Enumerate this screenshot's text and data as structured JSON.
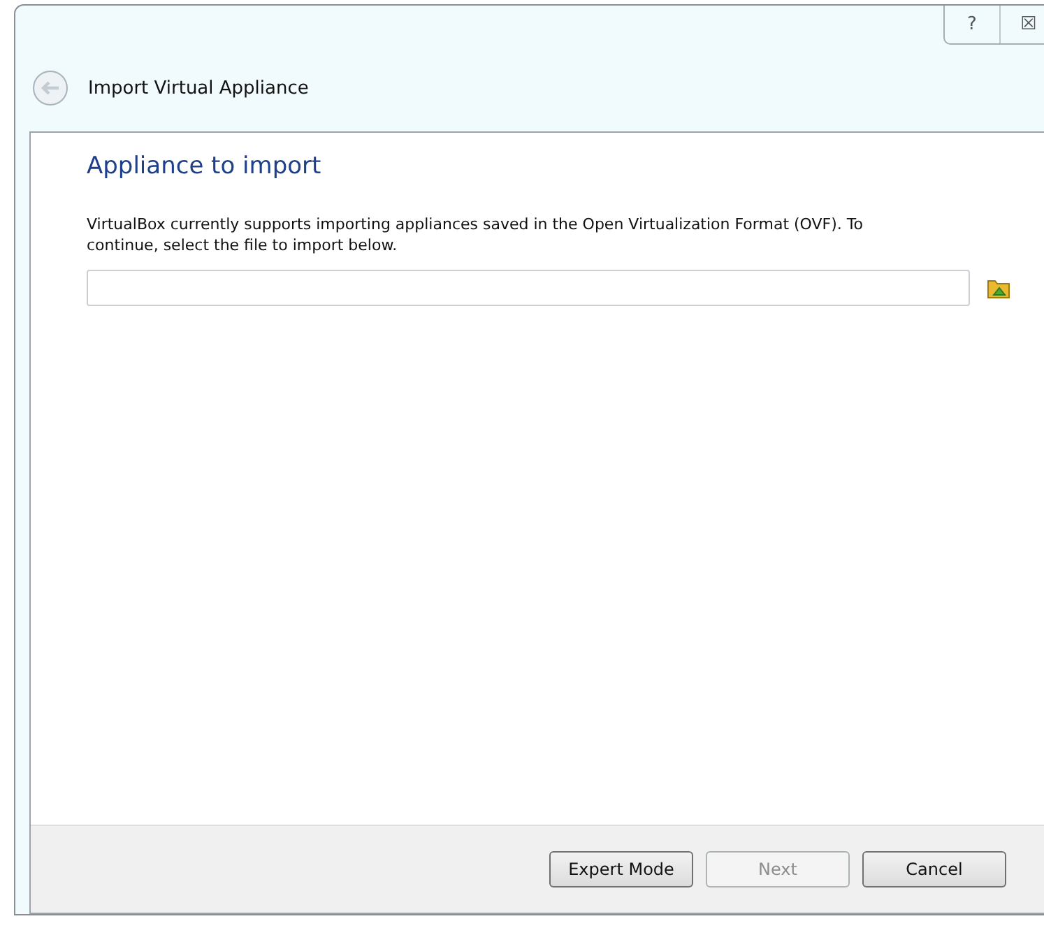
{
  "window": {
    "help_button": "?",
    "close_button": "☒"
  },
  "header": {
    "title": "Import Virtual Appliance"
  },
  "page": {
    "heading": "Appliance to import",
    "description": "VirtualBox currently supports importing appliances saved in the Open Virtualization Format (OVF). To continue, select the file to import below."
  },
  "buttons": [
    {
      "label": "Expert Mode",
      "disabled": false
    },
    {
      "label": "Next",
      "disabled": true
    },
    {
      "label": "Cancel",
      "disabled": false
    }
  ]
}
